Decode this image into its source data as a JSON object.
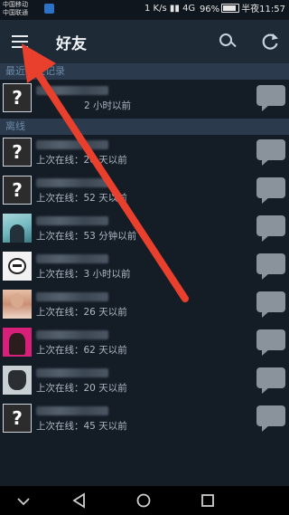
{
  "status_bar": {
    "carrier_1": "中国移动",
    "carrier_2": "中国联通",
    "speed": "1 K/s",
    "signal": "4G",
    "battery": "96%",
    "time": "半夜11:57"
  },
  "app_bar": {
    "title": "好友"
  },
  "sections": {
    "recent": "最近聊天记录",
    "offline": "离线"
  },
  "friends": [
    {
      "status": "2 小时以前",
      "avatar": "question-avatar"
    },
    {
      "status": "上次在线：26 天以前",
      "avatar": "question-avatar"
    },
    {
      "status": "上次在线：52 天以前",
      "avatar": "question-avatar"
    },
    {
      "status": "上次在线：53 分钟以前",
      "avatar": "photo-avatar"
    },
    {
      "status": "上次在线：3 小时以前",
      "avatar": "mask-avatar"
    },
    {
      "status": "上次在线：26 天以前",
      "avatar": "photo-avatar"
    },
    {
      "status": "上次在线：62 天以前",
      "avatar": "photo-avatar"
    },
    {
      "status": "上次在线：20 天以前",
      "avatar": "photo-avatar"
    },
    {
      "status": "上次在线：45 天以前",
      "avatar": "question-avatar"
    }
  ],
  "avatar_glyph": "?",
  "colors": {
    "background": "#141c26",
    "app_bar": "#1e2a36",
    "section_header": "#2b3a4c",
    "annotation_arrow": "#e8402c"
  }
}
